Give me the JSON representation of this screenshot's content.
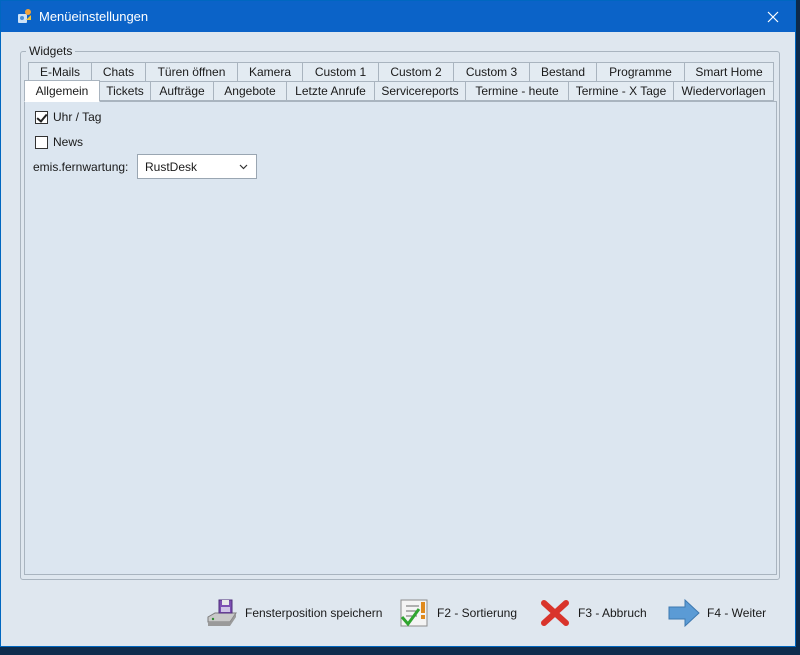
{
  "window": {
    "title": "Menüeinstellungen"
  },
  "group": {
    "label": "Widgets"
  },
  "tabs_row1": [
    "E-Mails",
    "Chats",
    "Türen öffnen",
    "Kamera",
    "Custom 1",
    "Custom 2",
    "Custom 3",
    "Bestand",
    "Programme",
    "Smart Home"
  ],
  "tabs_row2": [
    "Allgemein",
    "Tickets",
    "Aufträge",
    "Angebote",
    "Letzte Anrufe",
    "Servicereports",
    "Termine - heute",
    "Termine - X Tage",
    "Wiedervorlagen"
  ],
  "active_tab": "Allgemein",
  "panel": {
    "uhr_label": "Uhr / Tag",
    "uhr_checked": true,
    "news_label": "News",
    "news_checked": false,
    "fernwartung_label": "emis.fernwartung:",
    "fernwartung_value": "RustDesk"
  },
  "footer": {
    "save_label": "Fensterposition speichern",
    "sort_label": "F2 - Sortierung",
    "cancel_label": "F3 - Abbruch",
    "next_label": "F4 - Weiter"
  },
  "icons": {
    "title": "app-icon",
    "close": "close-icon",
    "save": "floppy-drive-icon",
    "sort": "checklist-icon",
    "cancel": "red-x-icon",
    "next": "arrow-right-icon"
  },
  "colors": {
    "titlebar": "#0b63c8",
    "window_bg": "#dfe7ef",
    "panel_bg": "#dce6f0"
  }
}
